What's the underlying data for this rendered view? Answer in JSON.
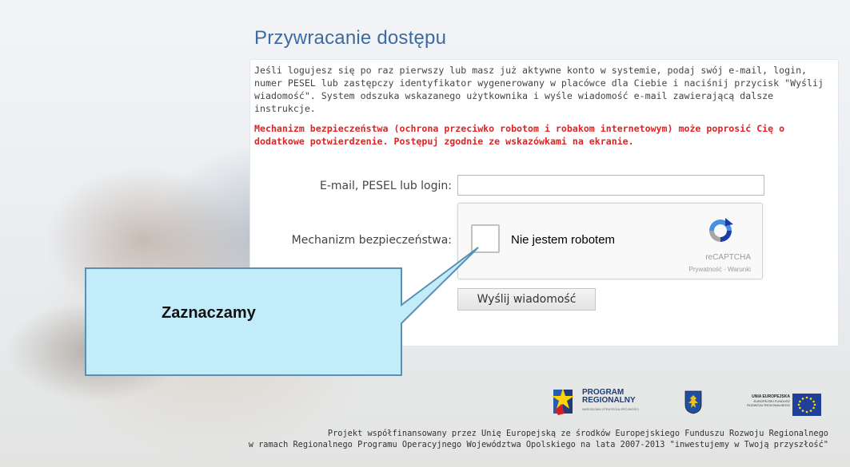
{
  "page": {
    "title": "Przywracanie dostępu",
    "intro": "Jeśli logujesz się po raz pierwszy lub masz już aktywne konto w systemie, podaj swój e-mail, login, numer PESEL lub zastępczy identyfikator wygenerowany w placówce dla Ciebie i naciśnij przycisk \"Wyślij wiadomość\". System odszuka wskazanego użytkownika i wyśle wiadomość e-mail zawierającą dalsze instrukcje.",
    "warning": "Mechanizm bezpieczeństwa (ochrona przeciwko robotom i robakom internetowym) może poprosić Cię o dodatkowe potwierdzenie. Postępuj zgodnie ze wskazówkami na ekranie."
  },
  "form": {
    "email_label": "E-mail, PESEL lub login:",
    "email_value": "",
    "security_label": "Mechanizm bezpieczeństwa:",
    "send_button": "Wyślij wiadomość"
  },
  "recaptcha": {
    "checkbox_label": "Nie jestem robotem",
    "brand": "reCAPTCHA",
    "terms": "Prywatność - Warunki",
    "checked": false
  },
  "callout": {
    "text": "Zaznaczamy",
    "fill": "#c3ecfa",
    "border": "#5b8fb3"
  },
  "logos": {
    "program_line1": "PROGRAM",
    "program_line2": "REGIONALNY",
    "program_line3": "NARODOWA STRATEGIA SPÓJNOŚCI",
    "ue_line1": "UNIA EUROPEJSKA",
    "ue_line2": "EUROPEJSKI FUNDUSZ",
    "ue_line3": "ROZWOJU REGIONALNEGO"
  },
  "footer": {
    "line1": "Projekt współfinansowany przez Unię Europejską ze środków Europejskiego Funduszu Rozwoju Regionalnego",
    "line2": "w ramach Regionalnego Programu Operacyjnego Województwa Opolskiego na lata 2007-2013 \"inwestujemy w Twoją przyszłość\""
  },
  "colors": {
    "title": "#3d6aa1",
    "warning": "#e12222",
    "text": "#444444"
  }
}
